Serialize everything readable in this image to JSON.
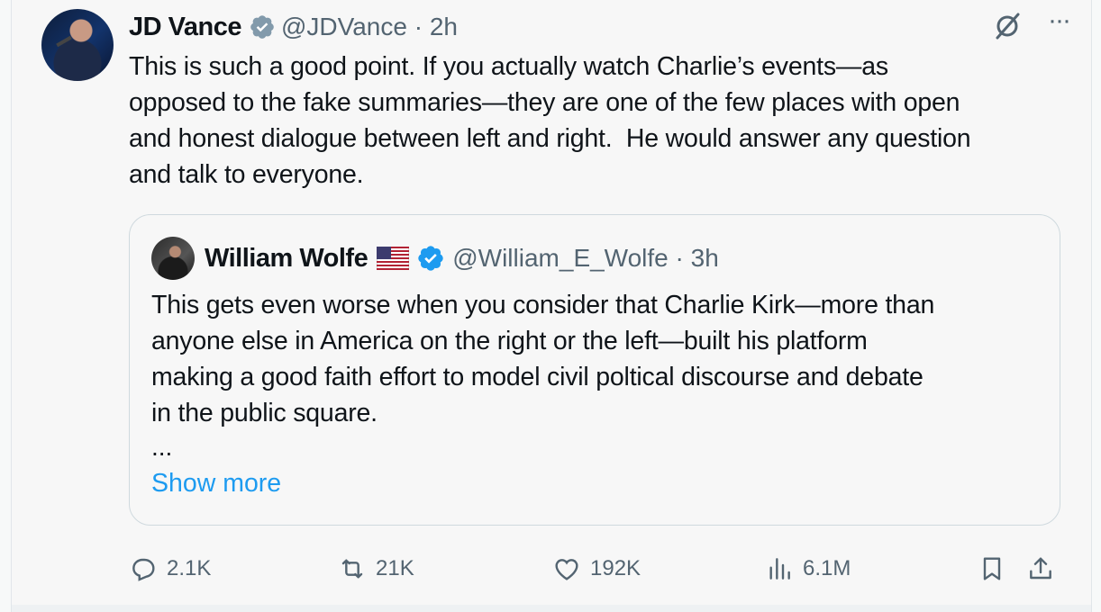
{
  "author": {
    "name": "JD Vance",
    "handle": "@JDVance",
    "separator": "·",
    "time": "2h",
    "verified_color": "#829aab"
  },
  "tweet": {
    "text": "This is such a good point. If you actually watch Charlie’s events—as\nopposed to the fake summaries—they are one of the few places with open\nand honest dialogue between left and right.  He would answer any question\nand talk to everyone."
  },
  "top_actions": {
    "grok_icon": "grok-icon",
    "more_label": "···"
  },
  "quoted": {
    "name": "William Wolfe",
    "flag_icon": "us-flag-icon",
    "handle": "@William_E_Wolfe",
    "separator": "·",
    "time": "3h",
    "verified_color": "#1d9bf0",
    "text": "This gets even worse when you consider that Charlie Kirk—more than\nanyone else in America on the right or the left—built his platform\nmaking a good faith effort to model civil poltical discourse and debate\nin the public square.",
    "ellipsis": "...",
    "show_more_label": "Show more",
    "link_color": "#1d9bf0"
  },
  "actions": {
    "replies": "2.1K",
    "reposts": "21K",
    "likes": "192K",
    "views": "6.1M"
  },
  "colors": {
    "text_primary": "#0f1419",
    "text_secondary": "#536471",
    "background": "#f7f7f7"
  }
}
